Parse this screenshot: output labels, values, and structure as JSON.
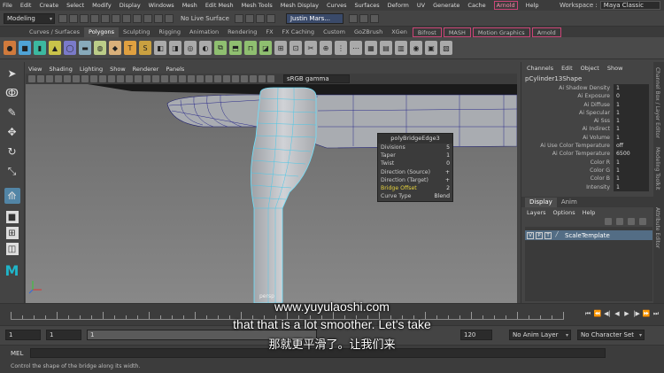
{
  "menubar": {
    "items": [
      "File",
      "Edit",
      "Create",
      "Select",
      "Modify",
      "Display",
      "Windows",
      "Mesh",
      "Edit Mesh",
      "Mesh Tools",
      "Mesh Display",
      "Curves",
      "Surfaces",
      "Deform",
      "UV",
      "Generate",
      "Cache",
      "Arnold",
      "Help"
    ],
    "workspace_label": "Workspace :",
    "workspace_value": "Maya Classic"
  },
  "statusline": {
    "mode": "Modeling",
    "live_surface": "No Live Surface",
    "user": "Justin Mars..."
  },
  "shelf_tabs": [
    "Curves / Surfaces",
    "Polygons",
    "Sculpting",
    "Rigging",
    "Animation",
    "Rendering",
    "FX",
    "FX Caching",
    "Custom",
    "GoZBrush",
    "XGen",
    "Bifrost",
    "MASH",
    "Motion Graphics",
    "Arnold"
  ],
  "shelf_active": "Polygons",
  "viewport": {
    "menu": [
      "View",
      "Shading",
      "Lighting",
      "Show",
      "Renderer",
      "Panels"
    ],
    "color_space": "sRGB gamma",
    "camera_label": "persp"
  },
  "bridge_popup": {
    "title": "polyBridgeEdge3",
    "rows": [
      {
        "label": "Divisions",
        "value": "5"
      },
      {
        "label": "Taper",
        "value": "1"
      },
      {
        "label": "Twist",
        "value": "0"
      },
      {
        "label": "Direction (Source)",
        "value": "+"
      },
      {
        "label": "Direction (Target)",
        "value": "+"
      },
      {
        "label": "Bridge Offset",
        "value": "2"
      },
      {
        "label": "Curve Type",
        "value": "Blend"
      }
    ]
  },
  "channel_box": {
    "menu": [
      "Channels",
      "Edit",
      "Object",
      "Show"
    ],
    "node": "pCylinder13Shape",
    "attrs": [
      {
        "label": "Ai Shadow Density",
        "value": "1"
      },
      {
        "label": "Ai Exposure",
        "value": "0"
      },
      {
        "label": "Ai Diffuse",
        "value": "1"
      },
      {
        "label": "Ai Specular",
        "value": "1"
      },
      {
        "label": "Ai Sss",
        "value": "1"
      },
      {
        "label": "Ai Indirect",
        "value": "1"
      },
      {
        "label": "Ai Volume",
        "value": "1"
      },
      {
        "label": "Ai Use Color Temperature",
        "value": "off"
      },
      {
        "label": "Ai Color Temperature",
        "value": "6500"
      },
      {
        "label": "Color R",
        "value": "1"
      },
      {
        "label": "Color G",
        "value": "1"
      },
      {
        "label": "Color B",
        "value": "1"
      },
      {
        "label": "Intensity",
        "value": "1"
      }
    ],
    "tabs": [
      "Display",
      "Anim"
    ],
    "layer_menu": [
      "Layers",
      "Options",
      "Help"
    ],
    "layer": {
      "v": "V",
      "p": "P",
      "t": "T",
      "name": "ScaleTemplate"
    }
  },
  "side_tabs": [
    "Channel Box / Layer Editor",
    "Modeling Toolkit",
    "Attribute Editor"
  ],
  "range": {
    "start": "1",
    "current": "1",
    "field3": "1",
    "end": "120",
    "anim_layer": "No Anim Layer",
    "character_set": "No Character Set"
  },
  "mel": {
    "label": "MEL"
  },
  "help_line": "Control the shape of the bridge along its width.",
  "subtitles": {
    "line1": "www.yuyulaoshi.com",
    "line2": "that that is a lot smoother. Let's take",
    "line3": "那就更平滑了。让我们来"
  },
  "colors": {
    "accent": "#5285a6",
    "highlight": "#e6d23c",
    "mesh_wire": "#6ee3ff"
  }
}
